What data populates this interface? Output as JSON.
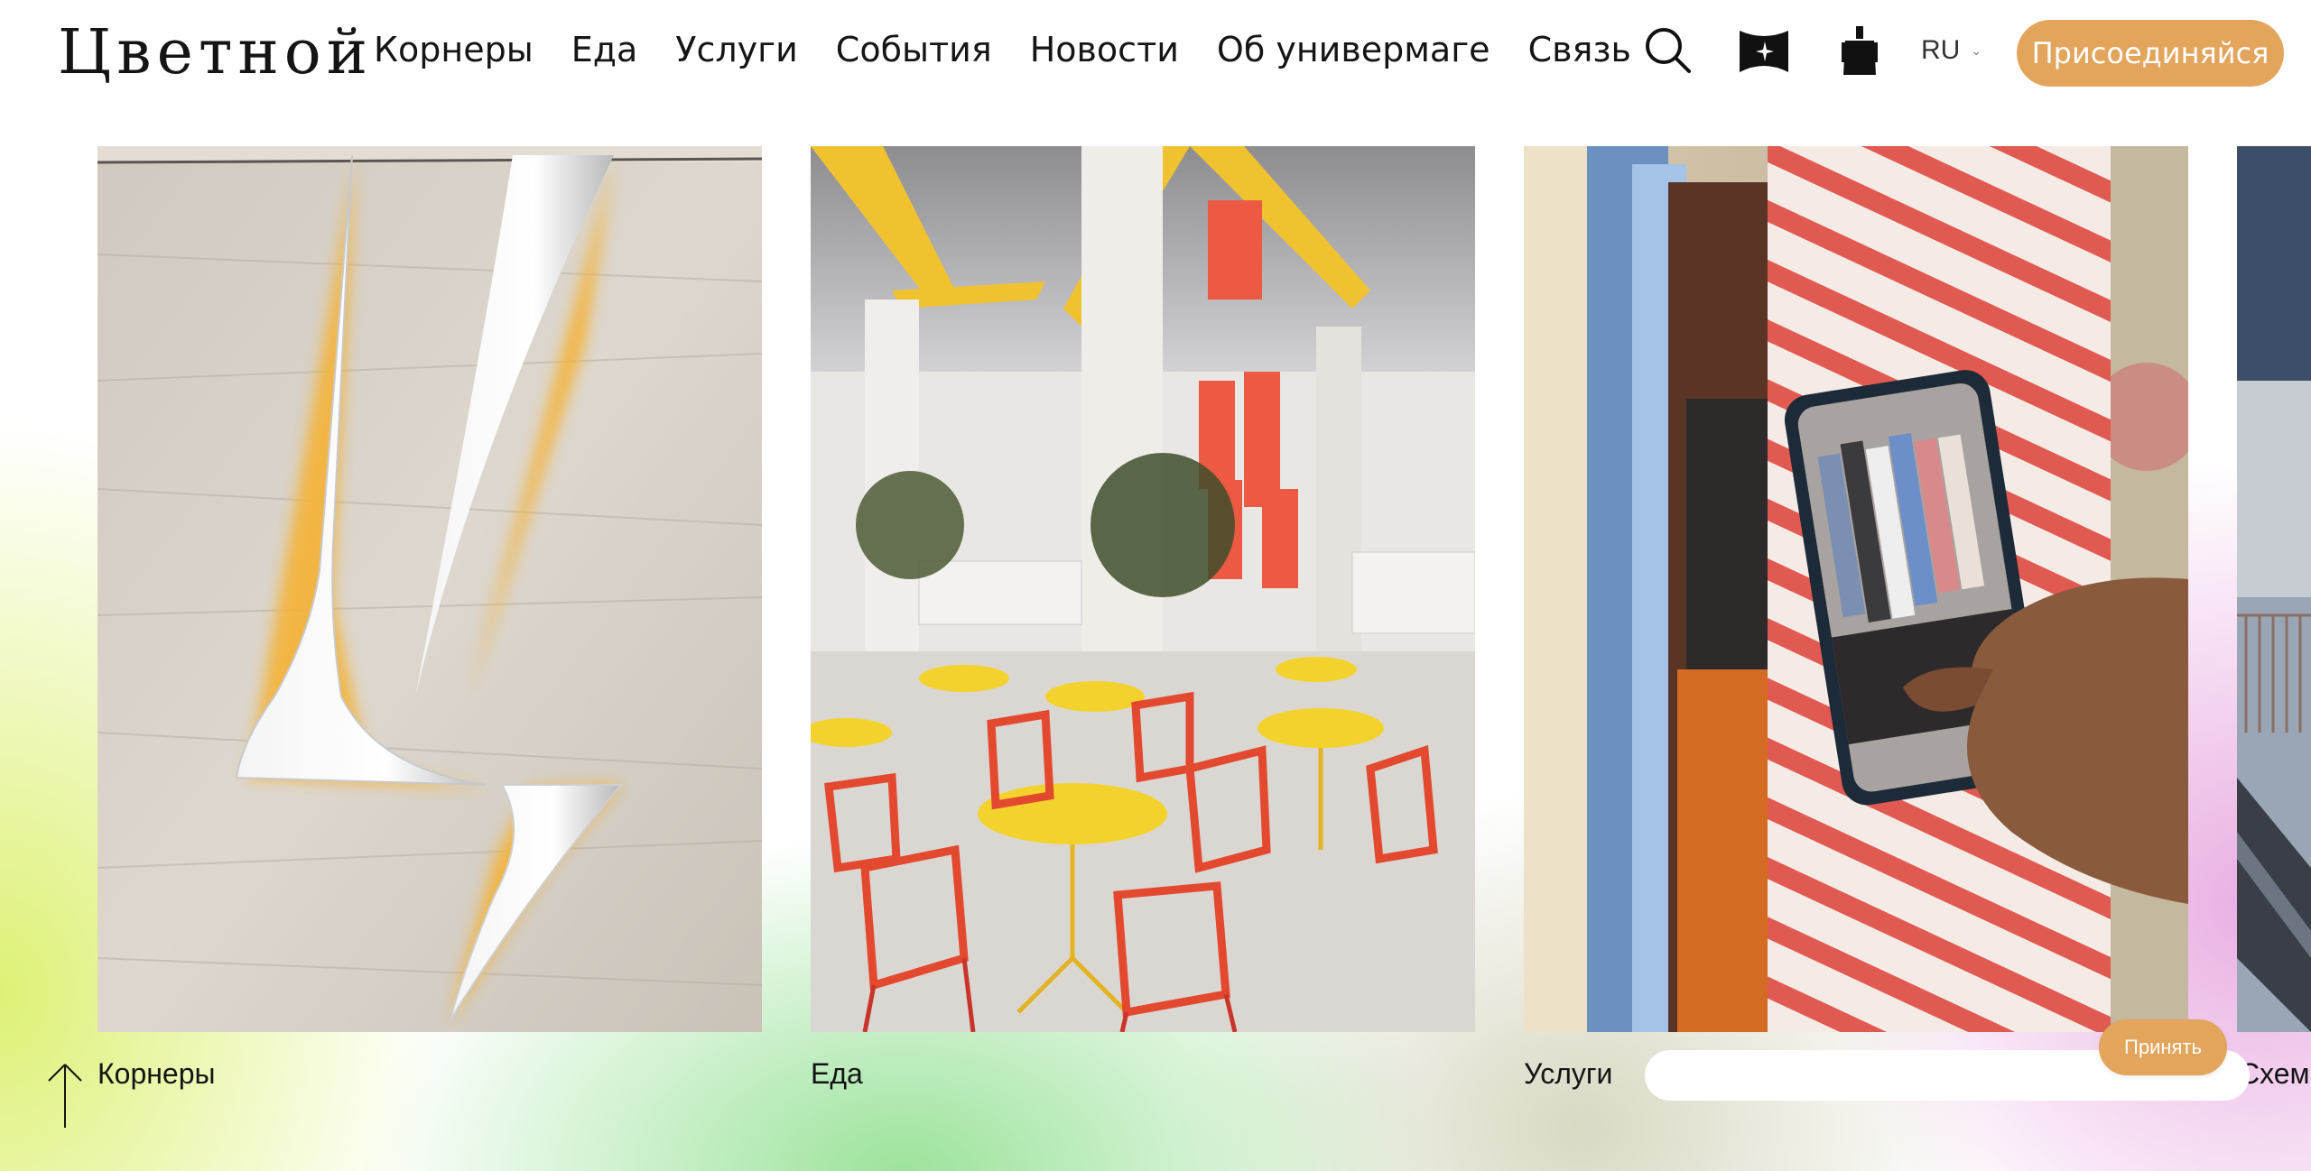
{
  "header": {
    "logo": "Цветной",
    "nav": [
      "Корнеры",
      "Еда",
      "Услуги",
      "События",
      "Новости",
      "Об универмаге",
      "Связь"
    ],
    "icons": [
      "search-icon",
      "map-icon",
      "clothes-hanger-icon"
    ],
    "language": "RU",
    "join_label": "Присоединяйся"
  },
  "cards": [
    {
      "label": "Корнеры",
      "image": "backlit-logo-on-travertine-wall"
    },
    {
      "label": "Еда",
      "image": "food-court-with-red-chairs-and-yellow-tables"
    },
    {
      "label": "Услуги",
      "image": "hand-holding-phone-photographing-clothes-rack"
    },
    {
      "label": "Схем",
      "image": "escalator-interior-partial"
    }
  ],
  "cookie": {
    "accept_label": "Принять"
  },
  "colors": {
    "accent": "#e3a45c",
    "text": "#141414"
  }
}
